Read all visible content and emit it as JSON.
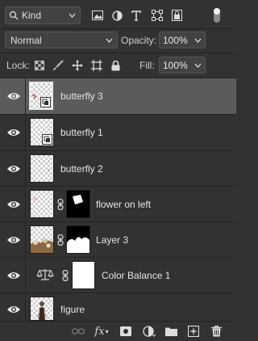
{
  "filter": {
    "kind_label": "Kind",
    "icons": [
      "search-icon",
      "image-filter-icon",
      "adjustment-filter-icon",
      "type-filter-icon",
      "shape-filter-icon",
      "smart-object-filter-icon",
      "filter-toggle-icon"
    ]
  },
  "blend": {
    "mode": "Normal",
    "opacity_label": "Opacity:",
    "opacity_value": "100%"
  },
  "lock": {
    "label": "Lock:",
    "fill_label": "Fill:",
    "fill_value": "100%",
    "icons": [
      "lock-transparent-pixels-icon",
      "lock-image-pixels-icon",
      "lock-position-icon",
      "lock-artboard-icon",
      "lock-all-icon"
    ]
  },
  "layers": [
    {
      "name": "butterfly 3",
      "selected": true,
      "has_mask": false
    },
    {
      "name": "butterfly 1",
      "selected": false,
      "has_mask": false
    },
    {
      "name": "butterfly 2",
      "selected": false,
      "has_mask": false
    },
    {
      "name": "flower on left",
      "selected": false,
      "has_mask": true
    },
    {
      "name": "Layer 3",
      "selected": false,
      "has_mask": true
    },
    {
      "name": "Color Balance 1",
      "selected": false,
      "adjustment": true
    },
    {
      "name": "figure",
      "selected": false,
      "has_mask": false
    }
  ],
  "bottom_bar": {
    "icons": [
      "link-layers-icon",
      "fx-icon",
      "add-mask-icon",
      "new-adjustment-icon",
      "new-group-icon",
      "new-layer-icon",
      "delete-icon"
    ],
    "fx_label": "fx"
  },
  "colors": {
    "panel_bg": "#323232",
    "selected_row": "#5b5b5b",
    "field_bg": "#424242"
  }
}
